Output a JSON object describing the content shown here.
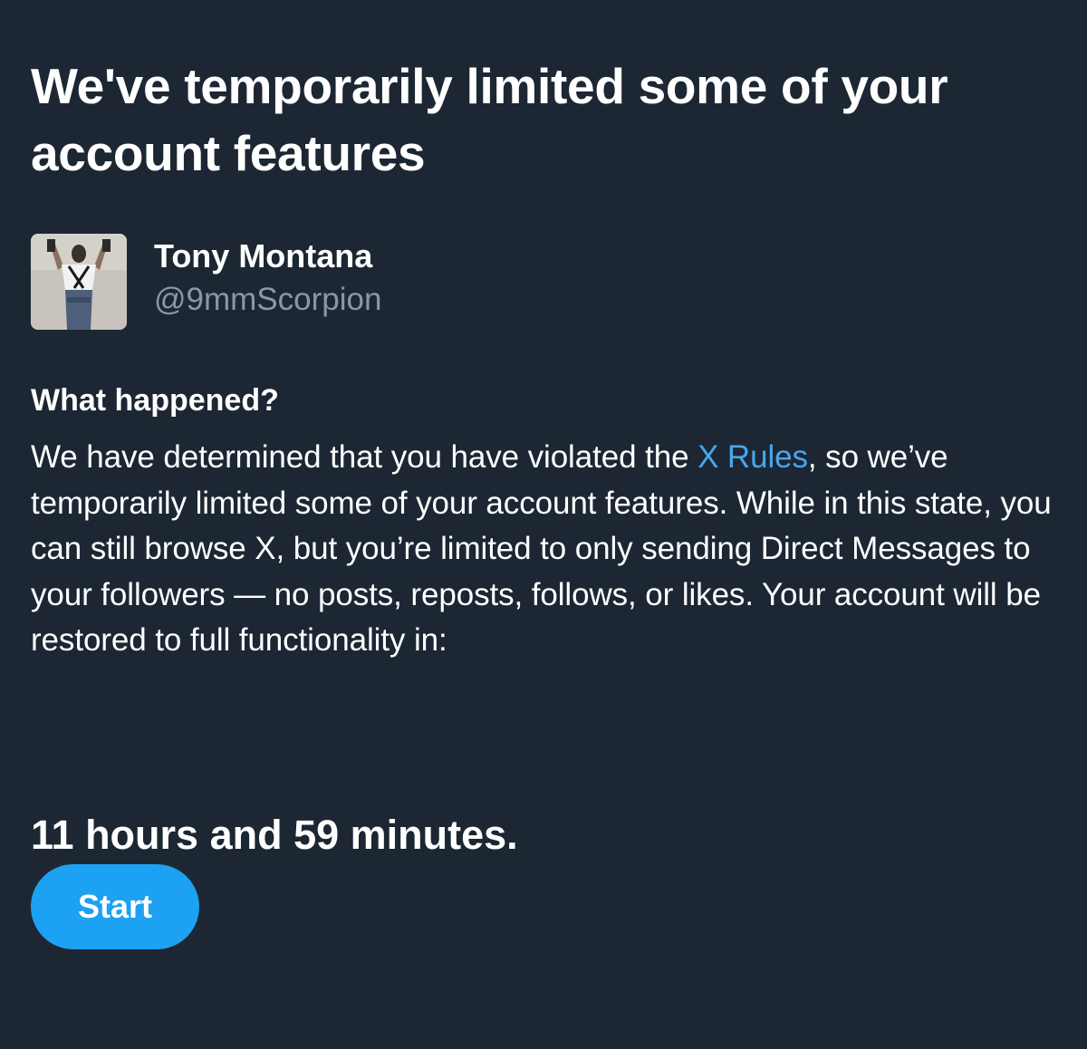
{
  "header": {
    "title": "We've temporarily limited some of your account features"
  },
  "account": {
    "display_name": "Tony Montana",
    "handle": "@9mmScorpion"
  },
  "section": {
    "heading": "What happened?",
    "body_before_link": "We have determined that you have violated the ",
    "link_text": "X Rules",
    "body_after_link": ", so we’ve temporarily limited some of your account features. While in this state, you can still browse X, but you’re limited to only sending Direct Messages to your followers — no posts, reposts, follows, or likes. Your account will be restored to full functionality in:"
  },
  "countdown": {
    "text": "11 hours and 59 minutes."
  },
  "actions": {
    "start_label": "Start"
  },
  "colors": {
    "background": "#1c2733",
    "text_primary": "#ffffff",
    "text_secondary": "#8899a6",
    "link": "#4aa6ec",
    "button": "#1da1f2"
  },
  "icons": {
    "avatar": "profile-photo"
  }
}
